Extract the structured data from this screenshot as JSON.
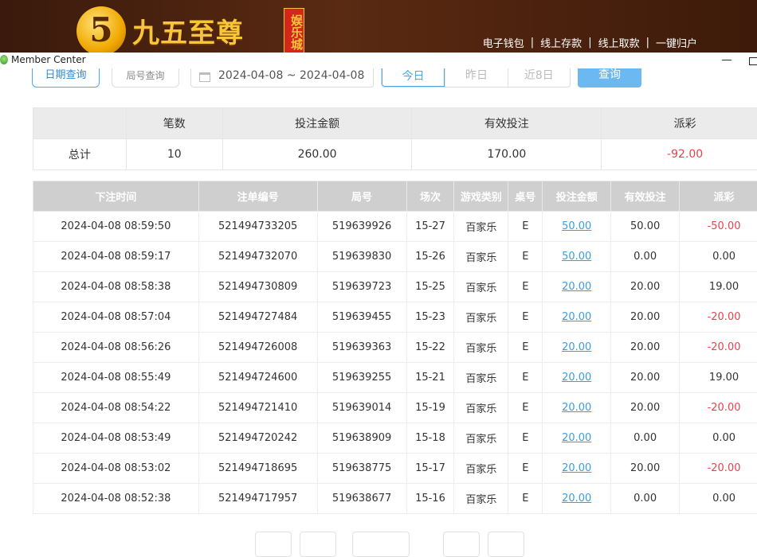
{
  "banner": {
    "logo_mark": "5",
    "logo_text": "九五至尊",
    "logo_badge": "娱乐城",
    "links": [
      "电子钱包",
      "线上存款",
      "线上取款",
      "一键归户"
    ],
    "separator": "|"
  },
  "window": {
    "title": "Member Center",
    "min_symbol": "—"
  },
  "toolbar": {
    "date_query": "日期查询",
    "round_query": "局号查询",
    "date_range": "2024-04-08 ~ 2024-04-08",
    "quick": [
      "今日",
      "昨日",
      "近8日"
    ],
    "search": "查询"
  },
  "summary": {
    "headers": [
      "",
      "笔数",
      "投注金额",
      "有效投注",
      "派彩"
    ],
    "row": {
      "label": "总计",
      "count": "10",
      "bet": "260.00",
      "valid": "170.00",
      "payout": "-92.00"
    }
  },
  "detail": {
    "headers": [
      "下注时间",
      "注单编号",
      "局号",
      "场次",
      "游戏类别",
      "桌号",
      "投注金额",
      "有效投注",
      "派彩"
    ],
    "rows": [
      [
        "2024-04-08 08:59:50",
        "521494733205",
        "519639926",
        "15-27",
        "百家乐",
        "E",
        "50.00",
        "50.00",
        "-50.00"
      ],
      [
        "2024-04-08 08:59:17",
        "521494732070",
        "519639830",
        "15-26",
        "百家乐",
        "E",
        "50.00",
        "0.00",
        "0.00"
      ],
      [
        "2024-04-08 08:58:38",
        "521494730809",
        "519639723",
        "15-25",
        "百家乐",
        "E",
        "20.00",
        "20.00",
        "19.00"
      ],
      [
        "2024-04-08 08:57:04",
        "521494727484",
        "519639455",
        "15-23",
        "百家乐",
        "E",
        "20.00",
        "20.00",
        "-20.00"
      ],
      [
        "2024-04-08 08:56:26",
        "521494726008",
        "519639363",
        "15-22",
        "百家乐",
        "E",
        "20.00",
        "20.00",
        "-20.00"
      ],
      [
        "2024-04-08 08:55:49",
        "521494724600",
        "519639255",
        "15-21",
        "百家乐",
        "E",
        "20.00",
        "20.00",
        "19.00"
      ],
      [
        "2024-04-08 08:54:22",
        "521494721410",
        "519639014",
        "15-19",
        "百家乐",
        "E",
        "20.00",
        "20.00",
        "-20.00"
      ],
      [
        "2024-04-08 08:53:49",
        "521494720242",
        "519638909",
        "15-18",
        "百家乐",
        "E",
        "20.00",
        "0.00",
        "0.00"
      ],
      [
        "2024-04-08 08:53:02",
        "521494718695",
        "519638775",
        "15-17",
        "百家乐",
        "E",
        "20.00",
        "20.00",
        "-20.00"
      ],
      [
        "2024-04-08 08:52:38",
        "521494717957",
        "519638677",
        "15-16",
        "百家乐",
        "E",
        "20.00",
        "0.00",
        "0.00"
      ]
    ]
  },
  "colors": {
    "accent": "#4aa8e8",
    "negative": "#e8414d",
    "header_bg": "#cfcfcf",
    "banner_bg": "#4a2210"
  }
}
